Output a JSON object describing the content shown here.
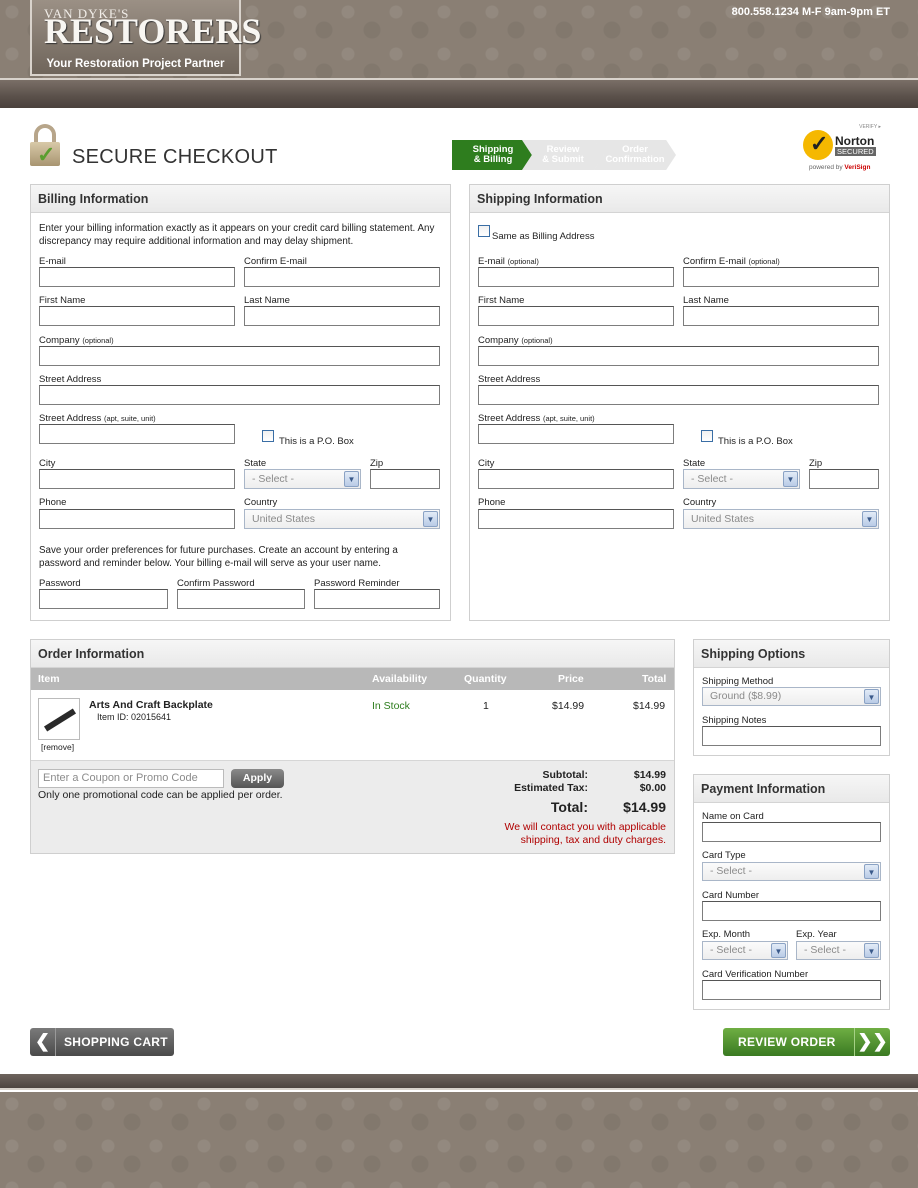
{
  "header": {
    "logo_top": "VAN DYKE'S",
    "logo_main": "RESTORERS",
    "tagline": "Your Restoration Project Partner",
    "phone": "800.558.1234 M-F 9am-9pm ET"
  },
  "checkout": {
    "title": "SECURE CHECKOUT",
    "steps": [
      {
        "line1": "Shipping",
        "line2": "& Billing"
      },
      {
        "line1": "Review",
        "line2": "& Submit"
      },
      {
        "line1": "Order",
        "line2": "Confirmation"
      }
    ],
    "norton": {
      "verify": "VERIFY ▸",
      "name": "Norton",
      "secured": "SECURED",
      "powered_prefix": "powered by ",
      "powered_brand": "VeriSign"
    }
  },
  "billing": {
    "title": "Billing Information",
    "intro": "Enter your billing information exactly as it appears on your credit card billing statement. Any discrepancy may require additional information and may delay shipment.",
    "email": "E-mail",
    "confirm_email": "Confirm E-mail",
    "first_name": "First Name",
    "last_name": "Last Name",
    "company": "Company",
    "optional": "(optional)",
    "street": "Street Address",
    "street2": "Street Address",
    "street2_note": "(apt, suite, unit)",
    "po_box": "This is a P.O. Box",
    "city": "City",
    "state": "State",
    "state_value": "- Select -",
    "zip": "Zip",
    "phone": "Phone",
    "country": "Country",
    "country_value": "United States",
    "account_text": "Save your order preferences for future purchases. Create an account by entering a password and reminder below. Your billing e-mail will serve as your user name.",
    "password": "Password",
    "confirm_password": "Confirm Password",
    "password_reminder": "Password Reminder"
  },
  "shipping": {
    "title": "Shipping Information",
    "same_as_billing": "Same as Billing Address",
    "email": "E-mail",
    "confirm_email": "Confirm E-mail",
    "optional": "(optional)",
    "first_name": "First Name",
    "last_name": "Last Name",
    "company": "Company",
    "street": "Street Address",
    "street2": "Street Address",
    "street2_note": "(apt, suite, unit)",
    "po_box": "This is a P.O. Box",
    "city": "City",
    "state": "State",
    "state_value": "- Select -",
    "zip": "Zip",
    "phone": "Phone",
    "country": "Country",
    "country_value": "United States"
  },
  "order": {
    "title": "Order Information",
    "columns": [
      "Item",
      "Availability",
      "Quantity",
      "Price",
      "Total"
    ],
    "item": {
      "name": "Arts And Craft Backplate",
      "id": "Item ID: 02015641",
      "remove": "[remove]",
      "availability": "In Stock",
      "quantity": "1",
      "price": "$14.99",
      "total": "$14.99"
    },
    "coupon_placeholder": "Enter a Coupon or Promo Code",
    "apply": "Apply",
    "promo_note": "Only one promotional code can be applied per order.",
    "subtotal_label": "Subtotal:",
    "subtotal": "$14.99",
    "tax_label": "Estimated Tax:",
    "tax": "$0.00",
    "total_label": "Total:",
    "total": "$14.99",
    "contact_note_1": "We will contact you with applicable",
    "contact_note_2": "shipping, tax and duty charges."
  },
  "shipping_options": {
    "title": "Shipping Options",
    "method_label": "Shipping Method",
    "method_value": "Ground ($8.99)",
    "notes_label": "Shipping Notes"
  },
  "payment": {
    "title": "Payment Information",
    "name_on_card": "Name on Card",
    "card_type": "Card Type",
    "card_type_value": "- Select -",
    "card_number": "Card Number",
    "exp_month": "Exp. Month",
    "exp_month_value": "- Select -",
    "exp_year": "Exp. Year",
    "exp_year_value": "- Select -",
    "cvv": "Card Verification Number"
  },
  "buttons": {
    "shopping_cart": "SHOPPING CART",
    "review_order": "REVIEW ORDER"
  },
  "colors": {
    "accent_green": "#2e7d1e",
    "header_brown": "#8a7f74",
    "error_red": "#b00000"
  }
}
